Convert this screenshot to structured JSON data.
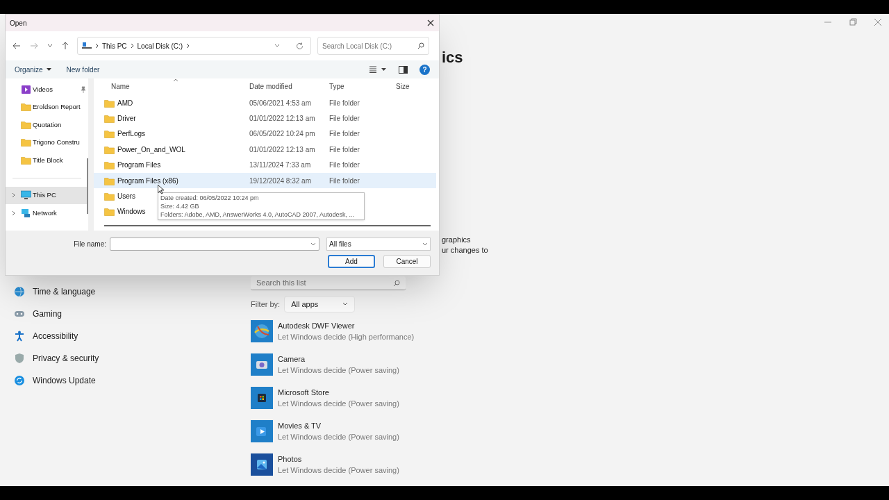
{
  "settings": {
    "heading": "ics",
    "description_lines": [
      "graphics",
      "ur changes to"
    ],
    "nav": [
      {
        "label": "Time & language"
      },
      {
        "label": "Gaming"
      },
      {
        "label": "Accessibility"
      },
      {
        "label": "Privacy & security"
      },
      {
        "label": "Windows Update"
      }
    ],
    "search": {
      "placeholder": "Search this list"
    },
    "filter": {
      "label": "Filter by:",
      "value": "All apps"
    },
    "apps": [
      {
        "name": "Autodesk DWF Viewer",
        "preference": "Let Windows decide (High performance)"
      },
      {
        "name": "Camera",
        "preference": "Let Windows decide (Power saving)"
      },
      {
        "name": "Microsoft Store",
        "preference": "Let Windows decide (Power saving)"
      },
      {
        "name": "Movies & TV",
        "preference": "Let Windows decide (Power saving)"
      },
      {
        "name": "Photos",
        "preference": "Let Windows decide (Power saving)"
      }
    ]
  },
  "dialog": {
    "title": "Open",
    "address": {
      "segments": [
        "This PC",
        "Local Disk (C:)"
      ]
    },
    "search": {
      "placeholder": "Search Local Disk (C:)"
    },
    "toolbar": {
      "buttons": [
        "Organize",
        "New folder"
      ],
      "help": "?"
    },
    "nav_pane": {
      "items": [
        {
          "label": "Videos",
          "kind": "video",
          "pinned": true,
          "selected": false,
          "expandable": false
        },
        {
          "label": "Eroldson Report",
          "kind": "folder",
          "pinned": false,
          "selected": false,
          "expandable": false
        },
        {
          "label": "Quotation",
          "kind": "folder",
          "pinned": false,
          "selected": false,
          "expandable": false
        },
        {
          "label": "Trigono Constru",
          "kind": "folder",
          "pinned": false,
          "selected": false,
          "expandable": false
        },
        {
          "label": "Title Block",
          "kind": "folder",
          "pinned": false,
          "selected": false,
          "expandable": false
        },
        {
          "label": "This PC",
          "kind": "pc",
          "pinned": false,
          "selected": true,
          "expandable": true
        },
        {
          "label": "Network",
          "kind": "network",
          "pinned": false,
          "selected": false,
          "expandable": true
        }
      ]
    },
    "columns": [
      "Name",
      "Date modified",
      "Type",
      "Size"
    ],
    "rows": [
      {
        "name": "AMD",
        "date": "05/06/2021 4:53 am",
        "type": "File folder",
        "selected": false
      },
      {
        "name": "Driver",
        "date": "01/01/2022 12:13 am",
        "type": "File folder",
        "selected": false
      },
      {
        "name": "PerfLogs",
        "date": "06/05/2022 10:24 pm",
        "type": "File folder",
        "selected": false
      },
      {
        "name": "Power_On_and_WOL",
        "date": "01/01/2022 12:13 am",
        "type": "File folder",
        "selected": false
      },
      {
        "name": "Program Files",
        "date": "13/11/2024 7:33 am",
        "type": "File folder",
        "selected": false
      },
      {
        "name": "Program Files (x86)",
        "date": "19/12/2024 8:32 am",
        "type": "File folder",
        "selected": true
      },
      {
        "name": "Users",
        "selected": false
      },
      {
        "name": "Windows",
        "selected": false
      }
    ],
    "tooltip": {
      "lines": [
        "Date created: 06/05/2022 10:24 pm",
        "Size: 4.42 GB",
        "Folders: Adobe, AMD, AnswerWorks 4.0, AutoCAD 2007, Autodesk, ..."
      ]
    },
    "file_name": {
      "label": "File name:"
    },
    "file_type": "All files",
    "buttons": [
      {
        "label": "Add",
        "default": true
      },
      {
        "label": "Cancel",
        "default": false
      }
    ]
  }
}
